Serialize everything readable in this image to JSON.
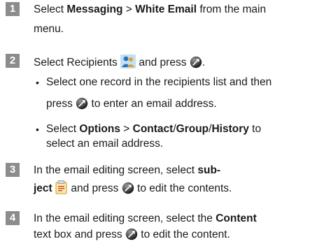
{
  "steps": [
    {
      "number": "1",
      "text_before": "Select ",
      "menu_a": "Messaging",
      "separator": " > ",
      "menu_b": "White Email",
      "text_after": " from the main",
      "line2": "menu."
    },
    {
      "number": "2",
      "text_before": "Select Recipients ",
      "text_mid": " and press ",
      "text_end": ".",
      "bullets": [
        {
          "line1": "Select one record in the recipients list and then",
          "line2_before": "press ",
          "line2_after": " to enter an email address."
        },
        {
          "line1_before": "Select ",
          "opt_a": "Options",
          "sep1": " > ",
          "opt_b": "Contact",
          "sep2": "/",
          "opt_c": "Group",
          "sep3": "/",
          "opt_d": "History",
          "line1_after": " to",
          "line2": "select an email address."
        }
      ]
    },
    {
      "number": "3",
      "line1_before": "In the email editing screen, select ",
      "line1_bold": "sub-",
      "line2_bold": "ject",
      "line2_mid": " and press ",
      "line2_after": " to edit the contents."
    },
    {
      "number": "4",
      "line1_before": "In the email editing screen, select the ",
      "line1_bold": "Content",
      "line2_before": "text box and press ",
      "line2_after": " to edit the content."
    }
  ],
  "bullet_char": "•",
  "icons": {
    "ok_key": "ok-key-icon",
    "recipients": "recipients-icon",
    "subject": "subject-icon"
  },
  "colors": {
    "step_badge": "#8c8c8c",
    "text": "#1a1a1a"
  }
}
